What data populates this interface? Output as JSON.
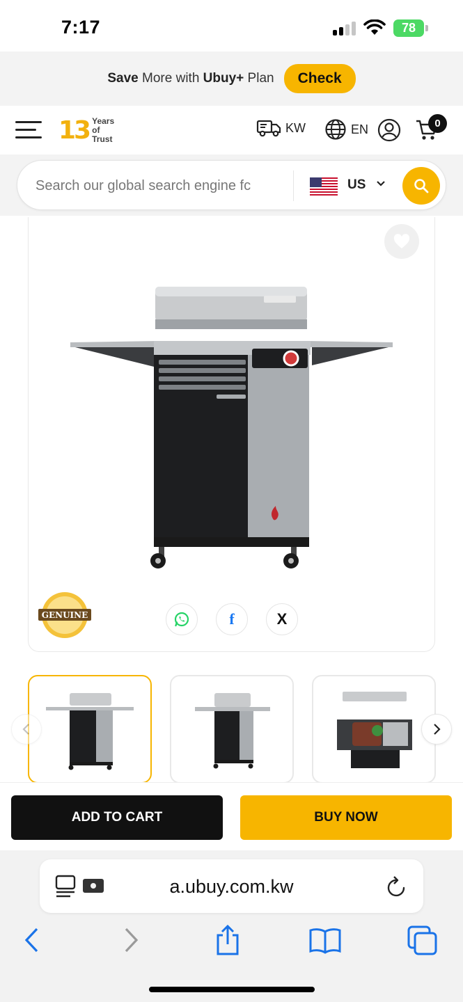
{
  "status_bar": {
    "time": "7:17",
    "battery": "78"
  },
  "promo": {
    "save_word": "Save",
    "text_mid": " More with ",
    "brand": "Ubuy+",
    "text_end": " Plan",
    "check_label": "Check"
  },
  "header": {
    "logo_number": "13",
    "logo_line1": "Years of",
    "logo_line2": "Trust",
    "shipping_country": "KW",
    "language": "EN",
    "cart_count": "0"
  },
  "search": {
    "placeholder": "Search our global search engine fc",
    "country": "US"
  },
  "product": {
    "badge_text": "GENUINE",
    "share": {
      "x_label": "X",
      "facebook_label": "f"
    }
  },
  "actions": {
    "add_to_cart": "ADD TO CART",
    "buy_now": "BUY NOW"
  },
  "browser": {
    "url": "a.ubuy.com.kw"
  },
  "colors": {
    "accent": "#f7b500",
    "dark": "#111111",
    "whatsapp": "#25d366",
    "facebook": "#1877f2",
    "ios_blue": "#1a73e8"
  }
}
